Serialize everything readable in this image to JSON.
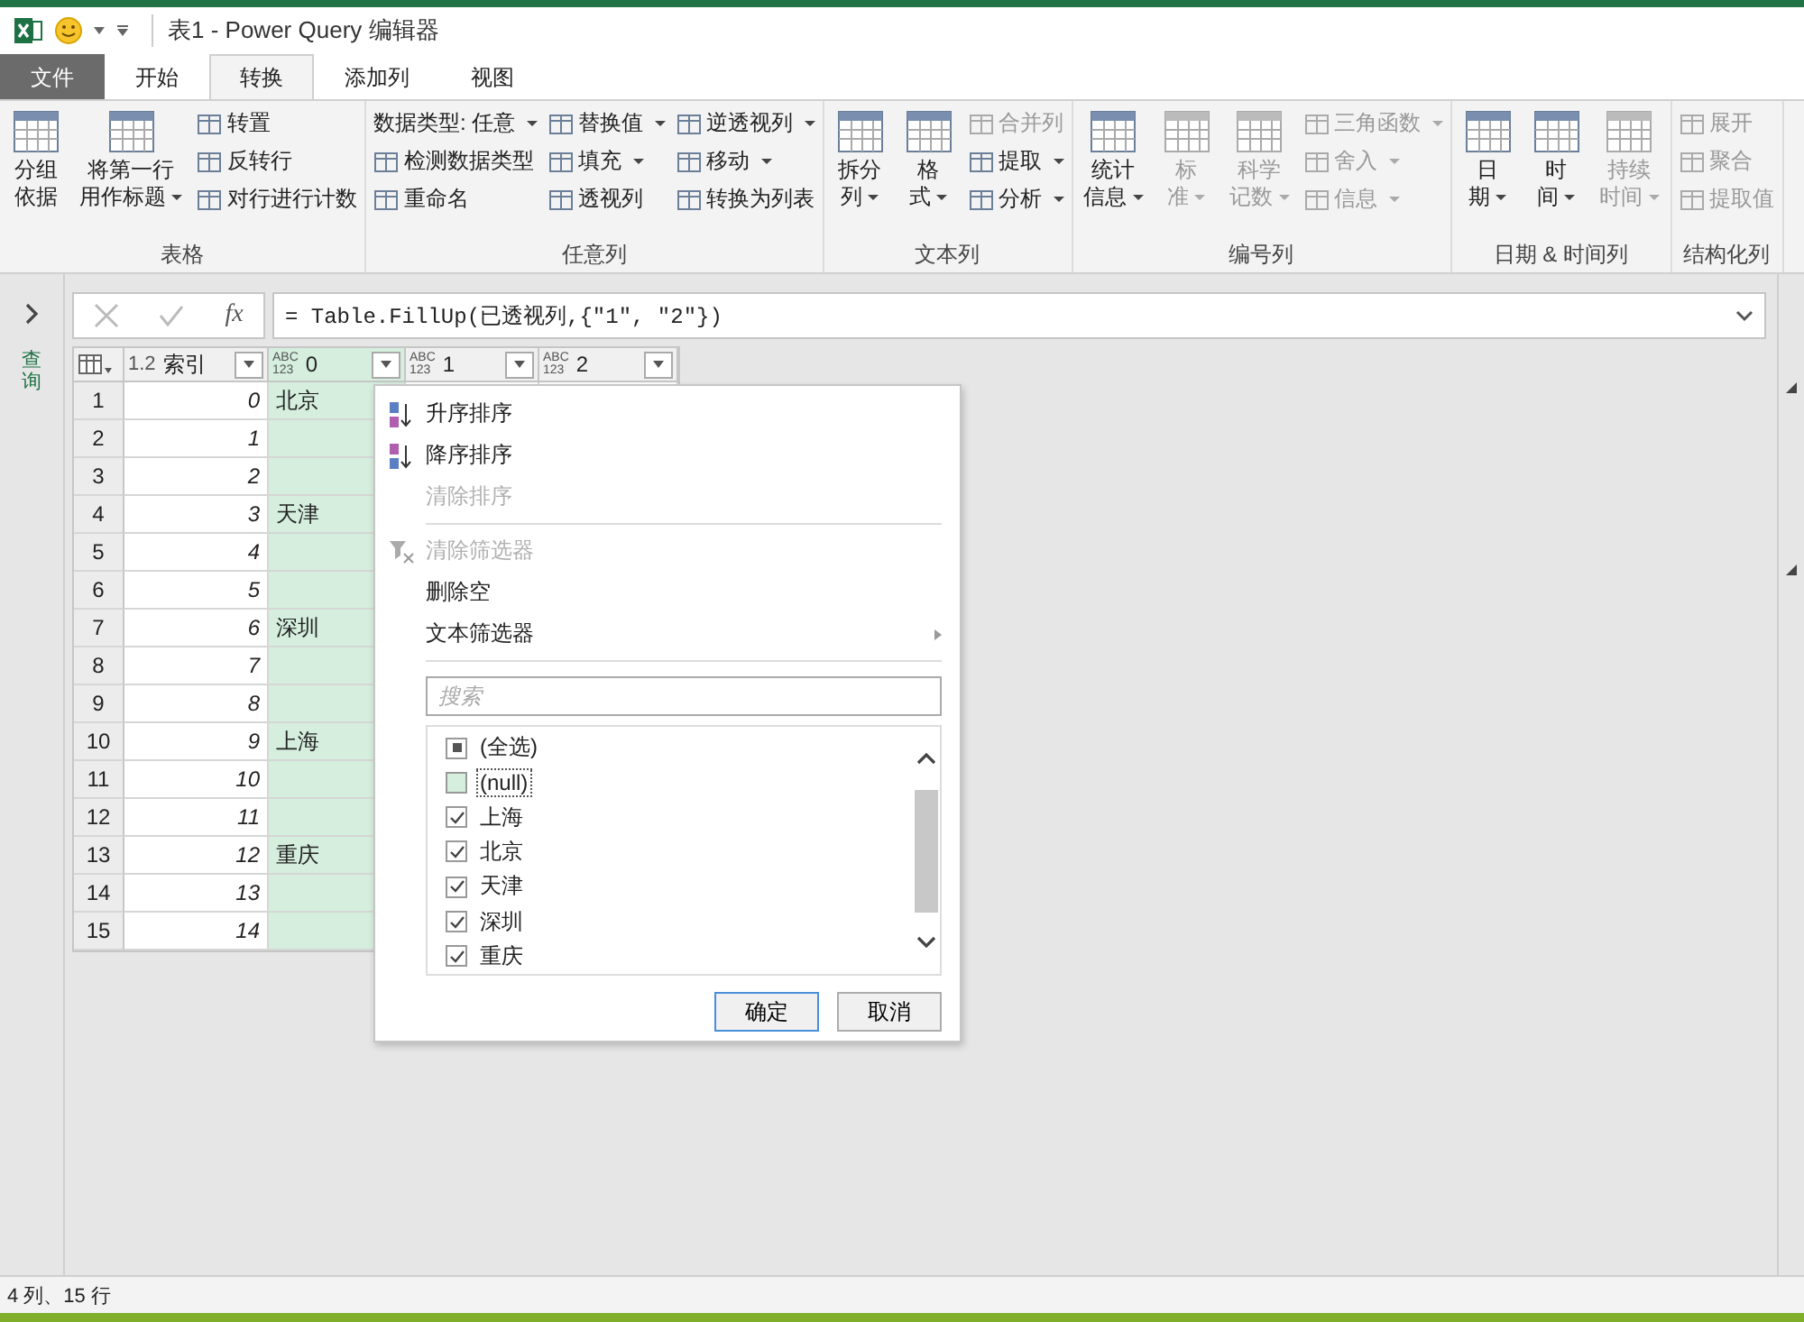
{
  "window": {
    "title": "表1 - Power Query 编辑器"
  },
  "tabs": [
    {
      "label": "文件",
      "kind": "file",
      "selected": false
    },
    {
      "label": "开始",
      "kind": "tab",
      "selected": false
    },
    {
      "label": "转换",
      "kind": "tab",
      "selected": true
    },
    {
      "label": "添加列",
      "kind": "tab",
      "selected": false
    },
    {
      "label": "视图",
      "kind": "tab",
      "selected": false
    }
  ],
  "ribbon": {
    "groups": [
      {
        "label": "表格",
        "columns": [
          {
            "kind": "large",
            "lines": [
              "分组",
              "依据"
            ],
            "dropdown": false,
            "disabled": false
          },
          {
            "kind": "large",
            "lines": [
              "将第一行",
              "用作标题"
            ],
            "dropdown": true,
            "disabled": false
          },
          {
            "kind": "stack",
            "items": [
              {
                "label": "转置",
                "dropdown": false,
                "disabled": false
              },
              {
                "label": "反转行",
                "dropdown": false,
                "disabled": false
              },
              {
                "label": "对行进行计数",
                "dropdown": false,
                "disabled": false
              }
            ]
          }
        ]
      },
      {
        "label": "任意列",
        "columns": [
          {
            "kind": "stack",
            "items": [
              {
                "label": "数据类型: 任意",
                "dropdown": true,
                "disabled": false,
                "noicon": true
              },
              {
                "label": "检测数据类型",
                "dropdown": false,
                "disabled": false
              },
              {
                "label": "重命名",
                "dropdown": false,
                "disabled": false
              }
            ]
          },
          {
            "kind": "stack",
            "items": [
              {
                "label": "替换值",
                "dropdown": true,
                "disabled": false
              },
              {
                "label": "填充",
                "dropdown": true,
                "disabled": false
              },
              {
                "label": "透视列",
                "dropdown": false,
                "disabled": false
              }
            ]
          },
          {
            "kind": "stack",
            "items": [
              {
                "label": "逆透视列",
                "dropdown": true,
                "disabled": false
              },
              {
                "label": "移动",
                "dropdown": true,
                "disabled": false
              },
              {
                "label": "转换为列表",
                "dropdown": false,
                "disabled": false
              }
            ]
          }
        ]
      },
      {
        "label": "文本列",
        "columns": [
          {
            "kind": "large",
            "lines": [
              "拆分",
              "列"
            ],
            "dropdown": true,
            "disabled": false
          },
          {
            "kind": "large",
            "lines": [
              "格",
              "式"
            ],
            "dropdown": true,
            "disabled": false
          },
          {
            "kind": "stack",
            "items": [
              {
                "label": "合并列",
                "dropdown": false,
                "disabled": true
              },
              {
                "label": "提取",
                "dropdown": true,
                "disabled": false
              },
              {
                "label": "分析",
                "dropdown": true,
                "disabled": false
              }
            ]
          }
        ]
      },
      {
        "label": "编号列",
        "columns": [
          {
            "kind": "large",
            "lines": [
              "统计",
              "信息"
            ],
            "dropdown": true,
            "disabled": false
          },
          {
            "kind": "large",
            "lines": [
              "标",
              "准"
            ],
            "dropdown": true,
            "disabled": true
          },
          {
            "kind": "large",
            "lines": [
              "科学",
              "记数"
            ],
            "dropdown": true,
            "disabled": true
          },
          {
            "kind": "stack",
            "items": [
              {
                "label": "三角函数",
                "dropdown": true,
                "disabled": true
              },
              {
                "label": "舍入",
                "dropdown": true,
                "disabled": true
              },
              {
                "label": "信息",
                "dropdown": true,
                "disabled": true
              }
            ]
          }
        ]
      },
      {
        "label": "日期 & 时间列",
        "columns": [
          {
            "kind": "large",
            "lines": [
              "日",
              "期"
            ],
            "dropdown": true,
            "disabled": false
          },
          {
            "kind": "large",
            "lines": [
              "时",
              "间"
            ],
            "dropdown": true,
            "disabled": false
          },
          {
            "kind": "large",
            "lines": [
              "持续",
              "时间"
            ],
            "dropdown": true,
            "disabled": true
          }
        ]
      },
      {
        "label": "结构化列",
        "columns": [
          {
            "kind": "stack",
            "items": [
              {
                "label": "展开",
                "dropdown": false,
                "disabled": true
              },
              {
                "label": "聚合",
                "dropdown": false,
                "disabled": true
              },
              {
                "label": "提取值",
                "dropdown": false,
                "disabled": true
              }
            ]
          }
        ]
      }
    ]
  },
  "queries_pane": {
    "label": "查询"
  },
  "formula_bar": {
    "fx": "fx",
    "formula": "= Table.FillUp(已透视列,{\"1\", \"2\"})"
  },
  "table": {
    "columns": [
      {
        "type": [
          "1.2"
        ],
        "name": "索引",
        "selected": false
      },
      {
        "type": [
          "ABC",
          "123"
        ],
        "name": "0",
        "selected": true
      },
      {
        "type": [
          "ABC",
          "123"
        ],
        "name": "1",
        "selected": false
      },
      {
        "type": [
          "ABC",
          "123"
        ],
        "name": "2",
        "selected": false
      }
    ],
    "rows": [
      {
        "n": "1",
        "index": "0",
        "value": "北京"
      },
      {
        "n": "2",
        "index": "1",
        "value": ""
      },
      {
        "n": "3",
        "index": "2",
        "value": ""
      },
      {
        "n": "4",
        "index": "3",
        "value": "天津"
      },
      {
        "n": "5",
        "index": "4",
        "value": ""
      },
      {
        "n": "6",
        "index": "5",
        "value": ""
      },
      {
        "n": "7",
        "index": "6",
        "value": "深圳"
      },
      {
        "n": "8",
        "index": "7",
        "value": ""
      },
      {
        "n": "9",
        "index": "8",
        "value": ""
      },
      {
        "n": "10",
        "index": "9",
        "value": "上海"
      },
      {
        "n": "11",
        "index": "10",
        "value": ""
      },
      {
        "n": "12",
        "index": "11",
        "value": ""
      },
      {
        "n": "13",
        "index": "12",
        "value": "重庆"
      },
      {
        "n": "14",
        "index": "13",
        "value": ""
      },
      {
        "n": "15",
        "index": "14",
        "value": ""
      }
    ]
  },
  "filter_menu": {
    "sections": [
      [
        {
          "label": "升序排序",
          "kind": "sort-asc",
          "disabled": false
        },
        {
          "label": "降序排序",
          "kind": "sort-desc",
          "disabled": false
        },
        {
          "label": "清除排序",
          "kind": "plain",
          "disabled": true
        }
      ],
      [
        {
          "label": "清除筛选器",
          "kind": "clear-filter",
          "disabled": true
        },
        {
          "label": "删除空",
          "kind": "plain",
          "disabled": false
        },
        {
          "label": "文本筛选器",
          "kind": "submenu",
          "disabled": false
        }
      ]
    ],
    "search": {
      "placeholder": "搜索"
    },
    "values": [
      {
        "label": "(全选)",
        "mixed": true,
        "focused": false
      },
      {
        "label": "(null)",
        "checked": false,
        "focused": true
      },
      {
        "label": "上海",
        "checked": true,
        "focused": false
      },
      {
        "label": "北京",
        "checked": true,
        "focused": false
      },
      {
        "label": "天津",
        "checked": true,
        "focused": false
      },
      {
        "label": "深圳",
        "checked": true,
        "focused": false
      },
      {
        "label": "重庆",
        "checked": true,
        "focused": false
      }
    ],
    "buttons": [
      {
        "label": "确定",
        "default": true
      },
      {
        "label": "取消",
        "default": false
      }
    ]
  },
  "status_bar": {
    "text": "4 列、15 行"
  }
}
